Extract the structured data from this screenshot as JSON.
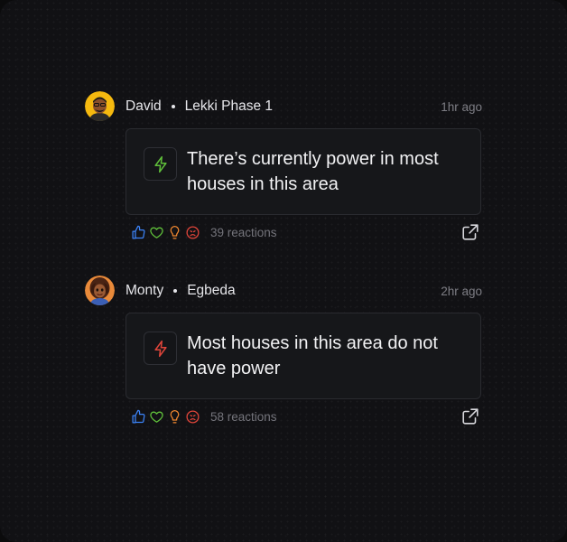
{
  "posts": [
    {
      "user": "David",
      "location": "Lekki Phase 1",
      "time": "1hr ago",
      "message": "There’s currently power in most houses in this area",
      "status_icon": "lightning-icon",
      "status_color": "#5fbf3a",
      "reactions_label": "39 reactions"
    },
    {
      "user": "Monty",
      "location": "Egbeda",
      "time": "2hr ago",
      "message": "Most houses in this area do not have power",
      "status_icon": "lightning-icon",
      "status_color": "#e0453a",
      "reactions_label": "58 reactions"
    }
  ],
  "reaction_icons": [
    "thumbs-up-icon",
    "heart-icon",
    "lightbulb-icon",
    "sad-face-icon"
  ],
  "colors": {
    "like": "#3b82f6",
    "heart": "#5fbf3a",
    "idea": "#f0872f",
    "sad": "#e0453a"
  }
}
